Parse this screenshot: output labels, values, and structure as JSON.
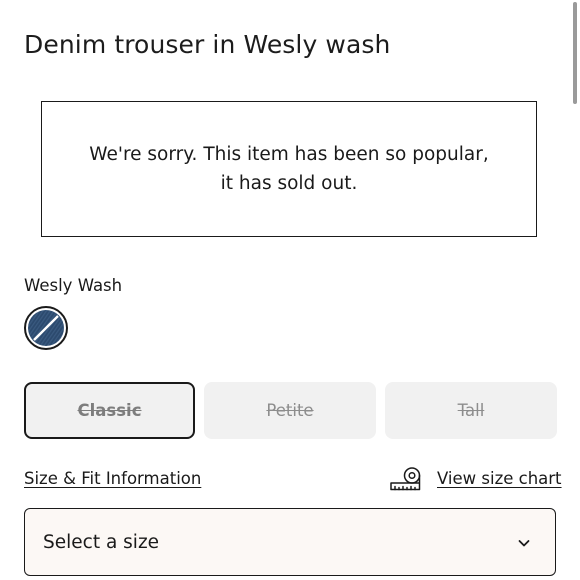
{
  "product": {
    "title": "Denim trouser in Wesly wash"
  },
  "sold_out": {
    "line1": "We're sorry. This item has been so popular,",
    "line2": "it has sold out."
  },
  "color": {
    "label": "Wesly Wash",
    "swatch_icon": "denim-swatch-unavailable-icon",
    "swatch_color": "#2c4a6e"
  },
  "fit_options": [
    {
      "label": "Classic",
      "selected": true,
      "available": false
    },
    {
      "label": "Petite",
      "selected": false,
      "available": false
    },
    {
      "label": "Tall",
      "selected": false,
      "available": false
    }
  ],
  "links": {
    "size_fit": "Size & Fit Information",
    "size_chart": "View size chart",
    "size_chart_icon": "measuring-tape-icon"
  },
  "size_select": {
    "placeholder": "Select a size",
    "icon": "chevron-down-icon"
  },
  "colors": {
    "text": "#1a1a1a",
    "option_bg": "#f1f1f1",
    "select_bg": "#fcf8f5"
  }
}
